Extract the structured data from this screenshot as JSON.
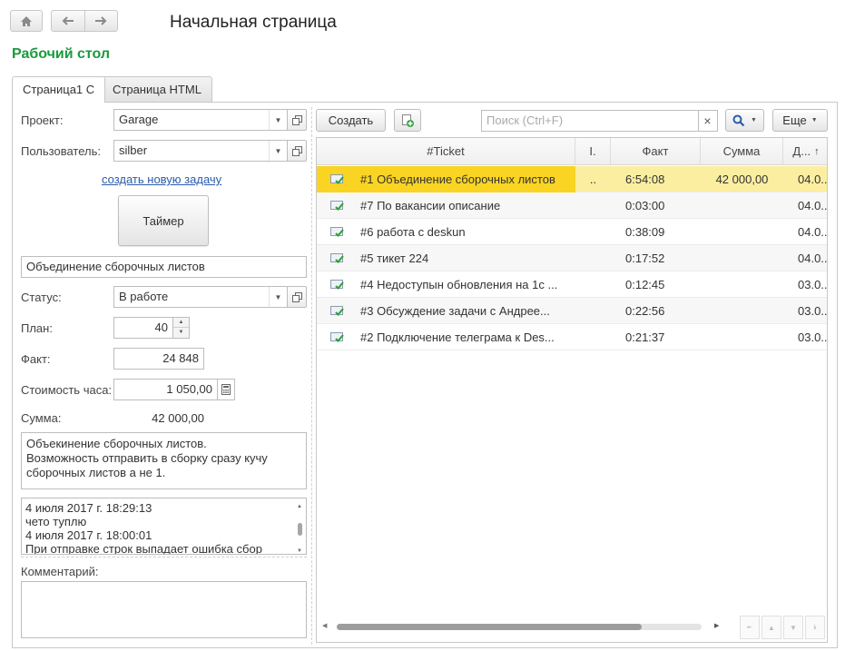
{
  "window": {
    "title": "Начальная страница",
    "section": "Рабочий стол"
  },
  "tabs": [
    {
      "label": "Страница1 С",
      "active": true
    },
    {
      "label": "Страница HTML",
      "active": false
    }
  ],
  "form": {
    "project_label": "Проект:",
    "project_value": "Garage",
    "user_label": "Пользователь:",
    "user_value": "silber",
    "create_task_link": "создать новую задачу",
    "timer_button": "Таймер",
    "task_name": "Объединение сборочных листов",
    "status_label": "Статус:",
    "status_value": "В работе",
    "plan_label": "План:",
    "plan_value": "40",
    "fact_label": "Факт:",
    "fact_value": "24 848",
    "rate_label": "Стоимость часа:",
    "rate_value": "1 050,00",
    "sum_label": "Сумма:",
    "sum_value": "42 000,00",
    "description_lines": [
      "Объекинение сборочных листов.",
      "Возможность отправить в сборку сразу кучу",
      "сборочных листов а не 1."
    ],
    "log_lines": [
      "4 июля 2017 г. 18:29:13",
      "чето туплю",
      "4 июля 2017 г. 18:00:01",
      "При отправке строк выпадает ошибка сбор"
    ],
    "comment_label": "Комментарий:",
    "comment_value": ""
  },
  "toolbar": {
    "create_button": "Создать",
    "search_placeholder": "Поиск (Ctrl+F)",
    "search_clear": "×",
    "more_button": "Еще"
  },
  "grid": {
    "columns": [
      "#Ticket",
      "I.",
      "Факт",
      "Сумма",
      "Д..."
    ],
    "rows": [
      {
        "ticket": "#1 Объединение сборочных листов",
        "i": "..",
        "fact": "6:54:08",
        "sum": "42 000,00",
        "date": "04.0...",
        "selected": true
      },
      {
        "ticket": "#7 По вакансии описание",
        "i": "",
        "fact": "0:03:00",
        "sum": "",
        "date": "04.0...",
        "selected": false
      },
      {
        "ticket": "#6 работа с deskun",
        "i": "",
        "fact": "0:38:09",
        "sum": "",
        "date": "04.0...",
        "selected": false
      },
      {
        "ticket": "#5 тикет 224",
        "i": "",
        "fact": "0:17:52",
        "sum": "",
        "date": "04.0...",
        "selected": false
      },
      {
        "ticket": "#4 Недоступын обновления на 1с ...",
        "i": "",
        "fact": "0:12:45",
        "sum": "",
        "date": "03.0...",
        "selected": false
      },
      {
        "ticket": "#3 Обсуждение задачи с Андрее...",
        "i": "",
        "fact": "0:22:56",
        "sum": "",
        "date": "03.0...",
        "selected": false
      },
      {
        "ticket": "#2 Подключение телеграма к Des...",
        "i": "",
        "fact": "0:21:37",
        "sum": "",
        "date": "03.0...",
        "selected": false
      }
    ]
  },
  "colors": {
    "section_title": "#1a9a3c",
    "selected_row": "#fbeea0",
    "selected_cell": "#f9d423",
    "link": "#2a5caa"
  },
  "icons": {
    "home": "home-icon",
    "back": "arrow-left-icon",
    "forward": "arrow-right-icon",
    "open": "open-window-icon",
    "copy_create": "copy-add-icon",
    "search": "search-icon",
    "ticket": "ticket-checked-icon",
    "calculator": "calculator-icon"
  }
}
